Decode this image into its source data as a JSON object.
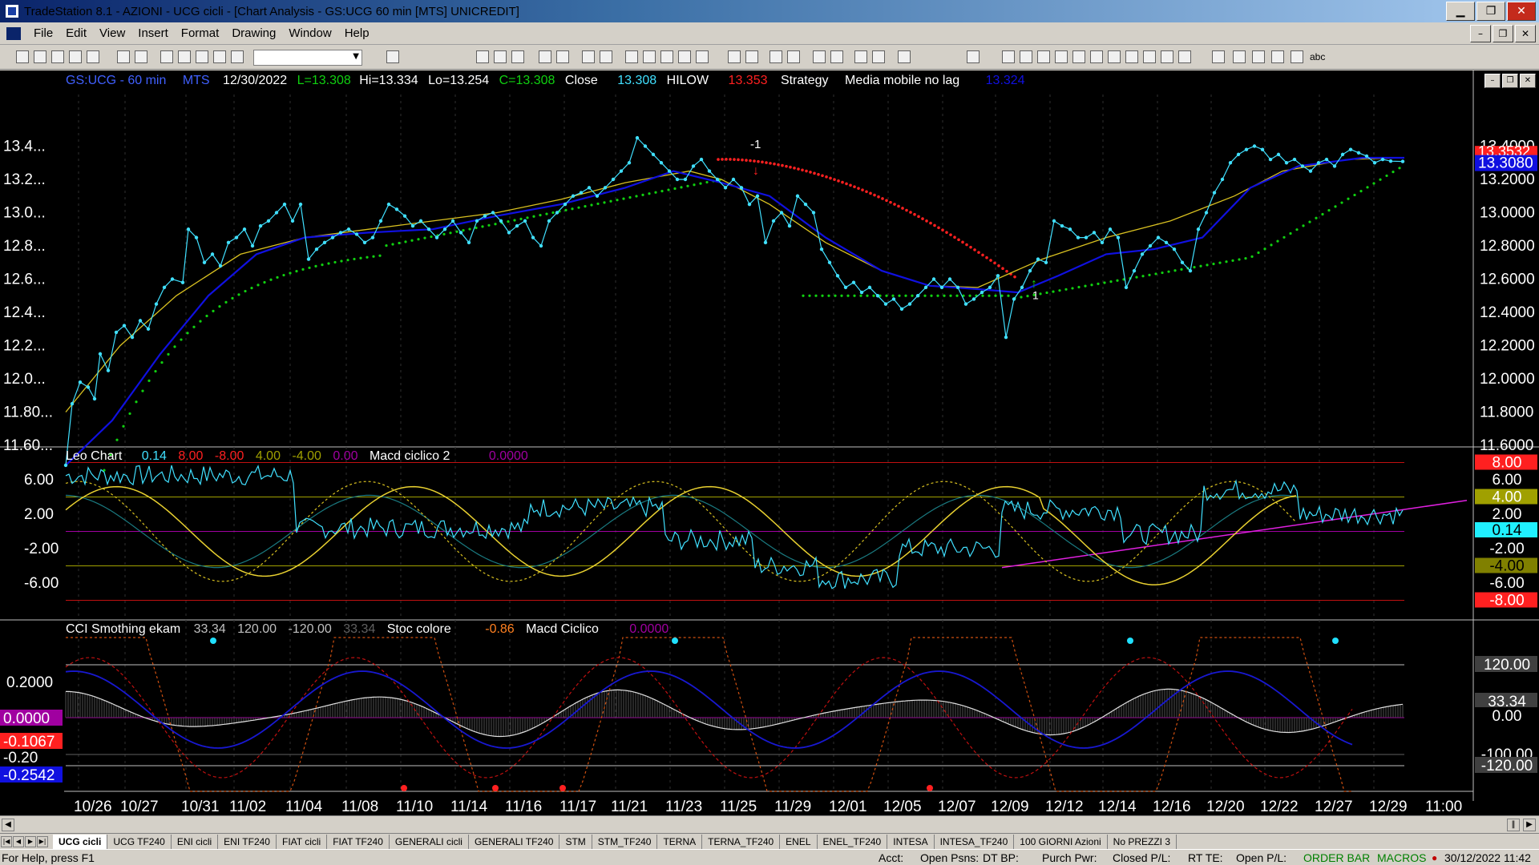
{
  "window": {
    "title": "TradeStation 8.1 - AZIONI - UCG cicli - [Chart Analysis - GS:UCG  60 min  [MTS] UNICREDIT]",
    "btn_min": "▁",
    "btn_max": "❐",
    "btn_close": "✕"
  },
  "menu": [
    "File",
    "Edit",
    "View",
    "Insert",
    "Format",
    "Drawing",
    "Window",
    "Help"
  ],
  "mdi_buttons": [
    "–",
    "❐",
    "✕"
  ],
  "toolbar": {
    "abc_label": "abc"
  },
  "chart": {
    "status_line": {
      "symbol": "GS:UCG - 60 min",
      "mts": "MTS",
      "date": "12/30/2022",
      "low": "L=13.308",
      "high": "Hi=13.334",
      "lo": "Lo=13.254",
      "close": "C=13.308",
      "close_label": "Close",
      "close_value": "13.308",
      "hilow_label": "HILOW",
      "hilow_value": "13.353",
      "strategy_label": "Strategy",
      "mm_label": "Media mobile no lag",
      "mm_value": "13.324"
    },
    "price_axis_right": [
      "13.4000",
      "13.2000",
      "13.0000",
      "12.8000",
      "12.6000",
      "12.4000",
      "12.2000",
      "12.0000",
      "11.8000",
      "11.6000"
    ],
    "price_axis_left": [
      "13.4...",
      "13.2...",
      "13.0...",
      "12.8...",
      "12.6...",
      "12.4...",
      "12.2...",
      "12.0...",
      "11.80...",
      "11.60..."
    ],
    "price_tags": {
      "red": "13.3532",
      "blue": "13.3080"
    },
    "trade_marks": {
      "short": "-1",
      "long": "1"
    },
    "panel2": {
      "label": "Leo Chart",
      "v1": "0.14",
      "v2": "8.00",
      "v3": "-8.00",
      "v4": "4.00",
      "v5": "-4.00",
      "v6": "0.00",
      "macd_label": "Macd ciclico 2",
      "macd_value": "0.0000",
      "left_axis": [
        "6.00",
        "2.00",
        "-2.00",
        "-6.00"
      ],
      "right_tags": [
        "8.00",
        "6.00",
        "4.00",
        "2.00",
        "0.14",
        "-2.00",
        "-4.00",
        "-6.00",
        "-8.00"
      ]
    },
    "panel3": {
      "label": "CCI Smothing ekam",
      "v1": "33.34",
      "v2": "120.00",
      "v3": "-120.00",
      "v4": "33.34",
      "stoc_label": "Stoc colore",
      "stoc_value": "-0.86",
      "macd_label": "Macd Ciclico",
      "macd_value": "0.0000",
      "left_axis": [
        "0.2000"
      ],
      "left_tags": [
        "0.0000",
        "-0.1067",
        "-0.20",
        "-0.2542"
      ],
      "right_tags": [
        "120.00",
        "33.34",
        "0.00",
        "-100.00",
        "-120.00"
      ]
    },
    "date_axis": [
      "10/26",
      "10/27",
      "10/31",
      "11/02",
      "11/04",
      "11/08",
      "11/10",
      "11/14",
      "11/16",
      "11/17",
      "11/21",
      "11/23",
      "11/25",
      "11/29",
      "12/01",
      "12/05",
      "12/07",
      "12/09",
      "12/12",
      "12/14",
      "12/16",
      "12/20",
      "12/22",
      "12/27",
      "12/29",
      "11:00"
    ]
  },
  "tabs": [
    "UCG cicli",
    "UCG TF240",
    "ENI cicli",
    "ENI TF240",
    "FIAT cicli",
    "FIAT TF240",
    "GENERALI cicli",
    "GENERALI TF240",
    "STM",
    "STM_TF240",
    "TERNA",
    "TERNA_TF240",
    "ENEL",
    "ENEL_TF240",
    "INTESA",
    "INTESA_TF240",
    "100 GIORNI Azioni",
    "No PREZZI 3"
  ],
  "tab_nav": [
    "|◀",
    "◀",
    "▶",
    "▶|"
  ],
  "statusbar": {
    "help": "For Help, press F1",
    "acct": "Acct:",
    "open_psns": "Open Psns:",
    "dt_bp": "DT BP:",
    "purch_pwr": "Purch Pwr:",
    "closed_pl": "Closed P/L:",
    "rt_te": "RT TE:",
    "open_pl": "Open P/L:",
    "order_bar": "ORDER BAR",
    "macros": "MACROS",
    "clock": "30/12/2022 11:42"
  },
  "colors": {
    "price": "#40e0ff",
    "blue_ma": "#1010e0",
    "yellow_ma": "#d8c020",
    "green_dots": "#10d010",
    "red_dots": "#ff2020",
    "magenta": "#e020e0",
    "background": "#000000"
  }
}
